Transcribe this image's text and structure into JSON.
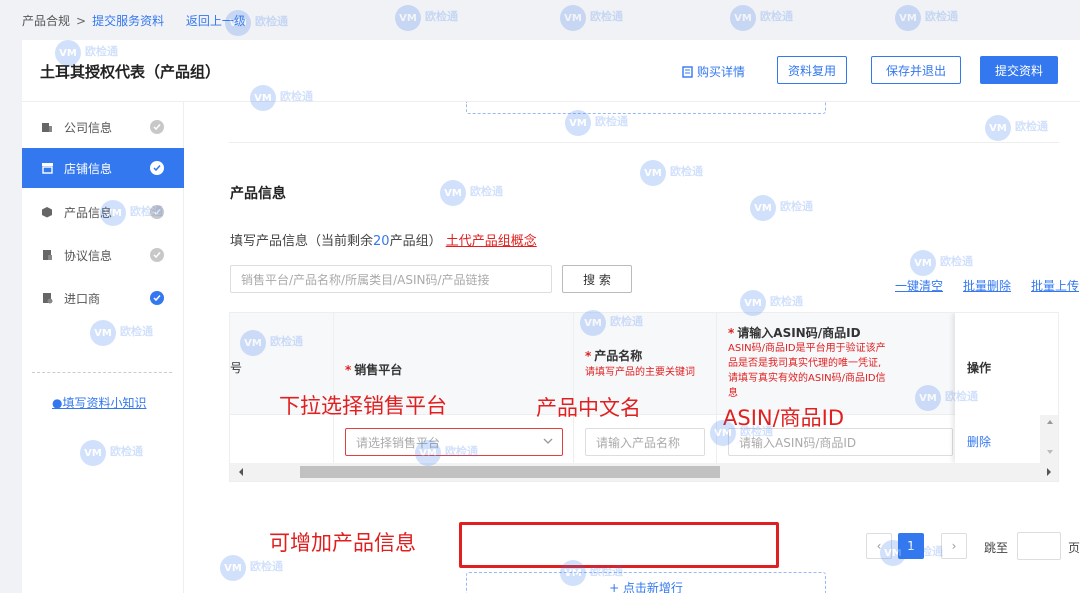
{
  "breadcrumb": {
    "root": "产品合规",
    "sep": ">",
    "current": "提交服务资料",
    "back": "返回上一级"
  },
  "header": {
    "title": "土耳其授权代表（产品组）",
    "detail_link": "购买详情",
    "reuse_btn": "资料复用",
    "save_btn": "保存并退出",
    "submit_btn": "提交资料"
  },
  "sidebar": {
    "items": [
      {
        "label": "公司信息",
        "icon": "building-icon"
      },
      {
        "label": "店铺信息",
        "icon": "store-icon",
        "active": true
      },
      {
        "label": "产品信息",
        "icon": "box-icon"
      },
      {
        "label": "协议信息",
        "icon": "document-icon"
      },
      {
        "label": "进口商",
        "icon": "importer-icon"
      }
    ],
    "tips": "填写资料小知识"
  },
  "section": {
    "title": "产品信息",
    "subtitle_pre": "填写产品信息（当前剩余",
    "subtitle_num": "20",
    "subtitle_post": "产品组）",
    "concept_link": "土代产品组概念"
  },
  "search": {
    "placeholder": "销售平台/产品名称/所属类目/ASIN码/产品链接",
    "button": "搜 索"
  },
  "actions": {
    "clear": "一键清空",
    "batch_delete": "批量删除",
    "batch_upload": "批量上传"
  },
  "table": {
    "col_no_partial": "号",
    "col_platform": "销售平台",
    "col_name": "产品名称",
    "col_name_hint": "请填写产品的主要关键词",
    "col_asin": "请输入ASIN码/商品ID",
    "col_asin_hint": [
      "ASIN码/商品ID是平台用于验证该产",
      "品是否是我司真实代理的唯一凭证,",
      "请填写真实有效的ASIN码/商品ID信",
      "息"
    ],
    "col_op": "操作",
    "required_mark": "*",
    "row": {
      "platform_placeholder": "请选择销售平台",
      "name_placeholder": "请输入产品名称",
      "asin_placeholder": "请输入ASIN码/商品ID",
      "delete": "删除"
    }
  },
  "pagination": {
    "current": "1",
    "jump_label": "跳至",
    "page_label": "页"
  },
  "add_row": "+ 点击新增行",
  "annotations": {
    "platform": "下拉选择销售平台",
    "name": "产品中文名",
    "asin": "ASIN/商品ID",
    "add": "可增加产品信息"
  },
  "watermark": {
    "circle": "VM",
    "text": "欧检通"
  },
  "colors": {
    "primary": "#3478ef",
    "annotation": "#e02020"
  }
}
